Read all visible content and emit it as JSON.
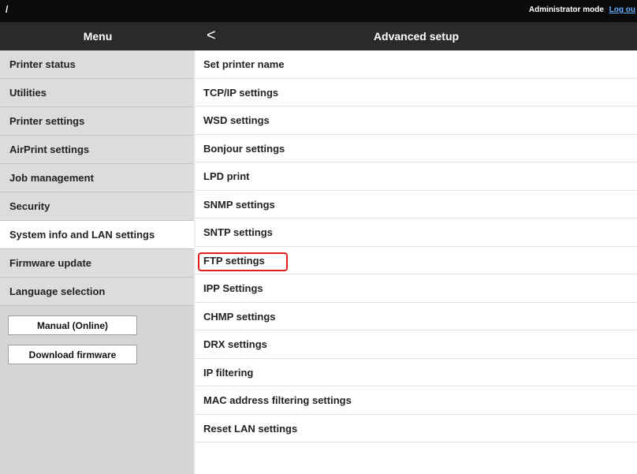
{
  "topbar": {
    "slash": "/",
    "mode_text": "Administrator mode",
    "logout_text": "Log ou"
  },
  "header": {
    "menu_title": "Menu",
    "back_glyph": "<",
    "panel_title": "Advanced setup"
  },
  "left_menu": {
    "items": [
      {
        "label": "Printer status"
      },
      {
        "label": "Utilities"
      },
      {
        "label": "Printer settings"
      },
      {
        "label": "AirPrint settings"
      },
      {
        "label": "Job management"
      },
      {
        "label": "Security"
      },
      {
        "label": "System info and LAN settings",
        "active": true
      },
      {
        "label": "Firmware update"
      },
      {
        "label": "Language selection"
      }
    ],
    "buttons": {
      "manual": "Manual (Online)",
      "download": "Download firmware"
    }
  },
  "advanced_setup": {
    "items": [
      {
        "label": "Set printer name"
      },
      {
        "label": "TCP/IP settings"
      },
      {
        "label": "WSD settings"
      },
      {
        "label": "Bonjour settings"
      },
      {
        "label": "LPD print"
      },
      {
        "label": "SNMP settings"
      },
      {
        "label": "SNTP settings"
      },
      {
        "label": "FTP settings",
        "highlighted": true
      },
      {
        "label": "IPP Settings"
      },
      {
        "label": "CHMP settings"
      },
      {
        "label": "DRX settings"
      },
      {
        "label": "IP filtering"
      },
      {
        "label": "MAC address filtering settings"
      },
      {
        "label": "Reset LAN settings"
      }
    ]
  },
  "colors": {
    "highlight_border": "#e02020",
    "header_bg": "#2a2a2a",
    "topbar_bg": "#0b0b0b",
    "menu_bg": "#dcdcdc"
  }
}
